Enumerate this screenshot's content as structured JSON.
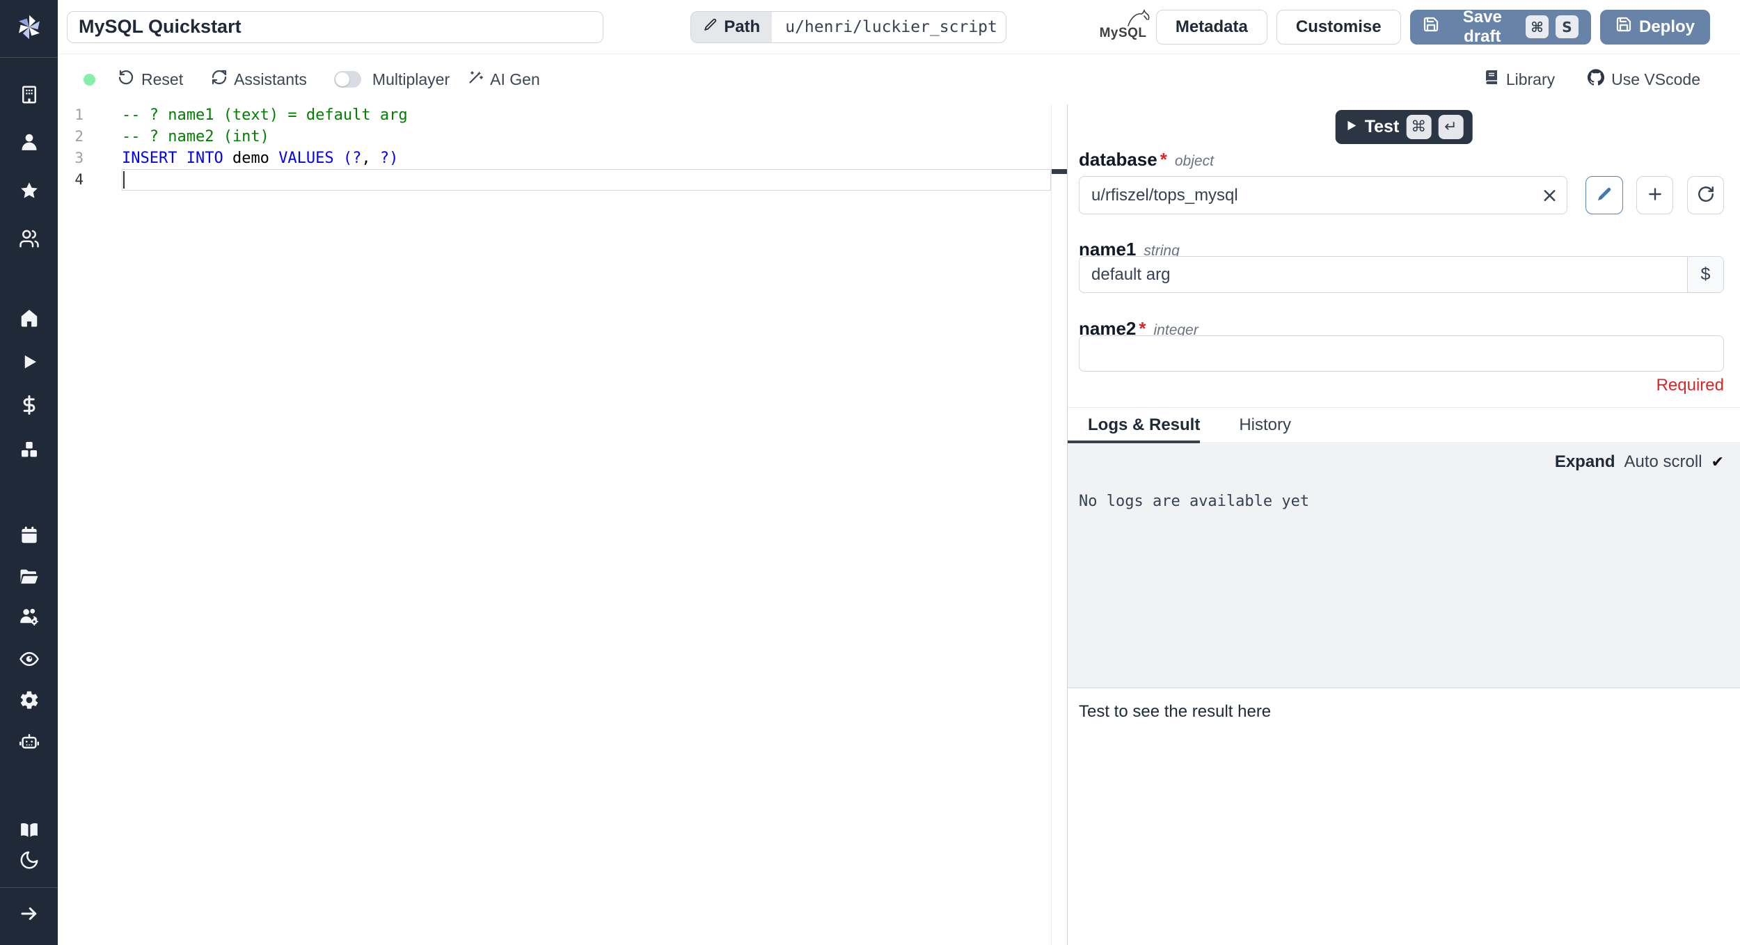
{
  "topbar": {
    "title_value": "MySQL Quickstart",
    "path_label": "Path",
    "path_value": "u/henri/luckier_script",
    "language_badge": "MySQL",
    "metadata_label": "Metadata",
    "customise_label": "Customise",
    "save_draft_label": "Save draft",
    "save_draft_kbd": [
      "⌘",
      "S"
    ],
    "deploy_label": "Deploy"
  },
  "toolbar": {
    "reset_label": "Reset",
    "assistants_label": "Assistants",
    "multiplayer_label": "Multiplayer",
    "multiplayer_enabled": false,
    "ai_gen_label": "AI Gen",
    "library_label": "Library",
    "vscode_label": "Use VScode"
  },
  "editor": {
    "language": "sql",
    "line_numbers": [
      "1",
      "2",
      "3",
      "4"
    ],
    "lines": [
      {
        "segments": [
          {
            "text": "-- ? name1 (text) = default arg",
            "type": "comment"
          }
        ]
      },
      {
        "segments": [
          {
            "text": "-- ? name2 (int)",
            "type": "comment"
          }
        ]
      },
      {
        "segments": [
          {
            "text": "INSERT INTO",
            "type": "keyword"
          },
          {
            "text": " demo ",
            "type": "plain"
          },
          {
            "text": "VALUES",
            "type": "keyword"
          },
          {
            "text": " ",
            "type": "plain"
          },
          {
            "text": "(?",
            "type": "keyword"
          },
          {
            "text": ", ",
            "type": "plain"
          },
          {
            "text": "?)",
            "type": "keyword"
          }
        ]
      },
      {
        "segments": []
      }
    ],
    "colors": {
      "comment": "#008000",
      "keyword": "#0000ff",
      "plain": "#000000"
    }
  },
  "panel": {
    "test_label": "Test",
    "test_kbd": [
      "⌘",
      "↵"
    ],
    "fields": {
      "database": {
        "label": "database",
        "required_marker": "*",
        "type": "object",
        "value": "u/rfiszel/tops_mysql"
      },
      "name1": {
        "label": "name1",
        "type": "string",
        "value": "default arg",
        "var_button": "$"
      },
      "name2": {
        "label": "name2",
        "required_marker": "*",
        "type": "integer",
        "value": "",
        "error": "Required"
      }
    },
    "tabs": [
      {
        "label": "Logs & Result",
        "active": true
      },
      {
        "label": "History",
        "active": false
      }
    ],
    "expand_label": "Expand",
    "autoscroll_label": "Auto scroll",
    "autoscroll_check": "✔",
    "logs_empty": "No logs are available yet",
    "result_placeholder": "Test to see the result here"
  },
  "sidebar": {
    "icons": [
      "windmill-logo",
      "building",
      "user",
      "star",
      "users",
      "home",
      "play",
      "dollar-sign",
      "boxes",
      "calendar",
      "folder-open",
      "users-cog",
      "eye",
      "settings",
      "bot",
      "book-open",
      "moon",
      "arrow-right"
    ]
  },
  "colors": {
    "sidebar_bg": "#1f2937",
    "primary_button": "#6784a8",
    "test_button": "#2b3544",
    "accent_blue": "#4678ae",
    "error_red": "#dc2626",
    "status_green": "#86efac",
    "comment_green": "#008000",
    "keyword_blue": "#0000ff"
  }
}
